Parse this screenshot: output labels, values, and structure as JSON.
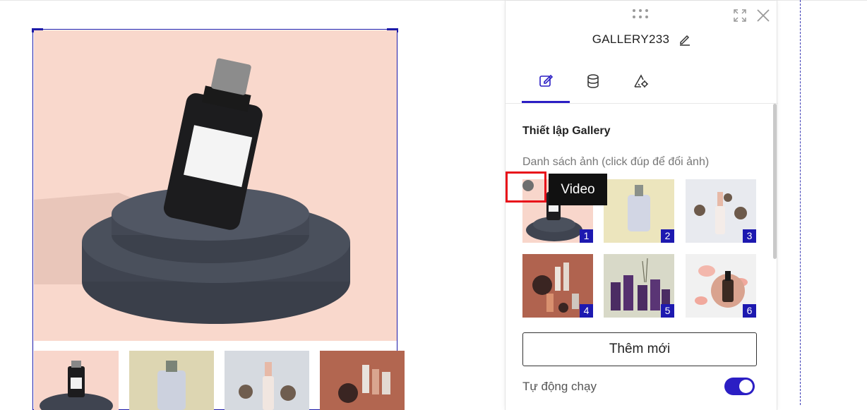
{
  "panel": {
    "title": "GALLERY233",
    "tabs": [
      {
        "name": "edit-tab",
        "icon": "pencil-edit-icon",
        "active": true
      },
      {
        "name": "data-tab",
        "icon": "database-icon",
        "active": false
      },
      {
        "name": "settings-tab",
        "icon": "ruler-gear-icon",
        "active": false
      }
    ],
    "section_title": "Thiết lập Gallery",
    "list_label": "Danh sách ảnh (click đúp để đổi ảnh)",
    "images": [
      {
        "number": "1",
        "subject": "black bottle on podium"
      },
      {
        "number": "2",
        "subject": "white bottle on yellow"
      },
      {
        "number": "3",
        "subject": "dropper bottle with flowers"
      },
      {
        "number": "4",
        "subject": "cosmetic set on terracotta"
      },
      {
        "number": "5",
        "subject": "purple bottles"
      },
      {
        "number": "6",
        "subject": "serum with petals"
      }
    ],
    "add_button": "Thêm mới",
    "autoplay_label": "Tự động chạy",
    "autoplay_on": true
  },
  "tooltip": {
    "text": "Video"
  },
  "colors": {
    "accent": "#2b1ec4",
    "highlight": "#e8101a",
    "badge": "#1d19b0"
  }
}
